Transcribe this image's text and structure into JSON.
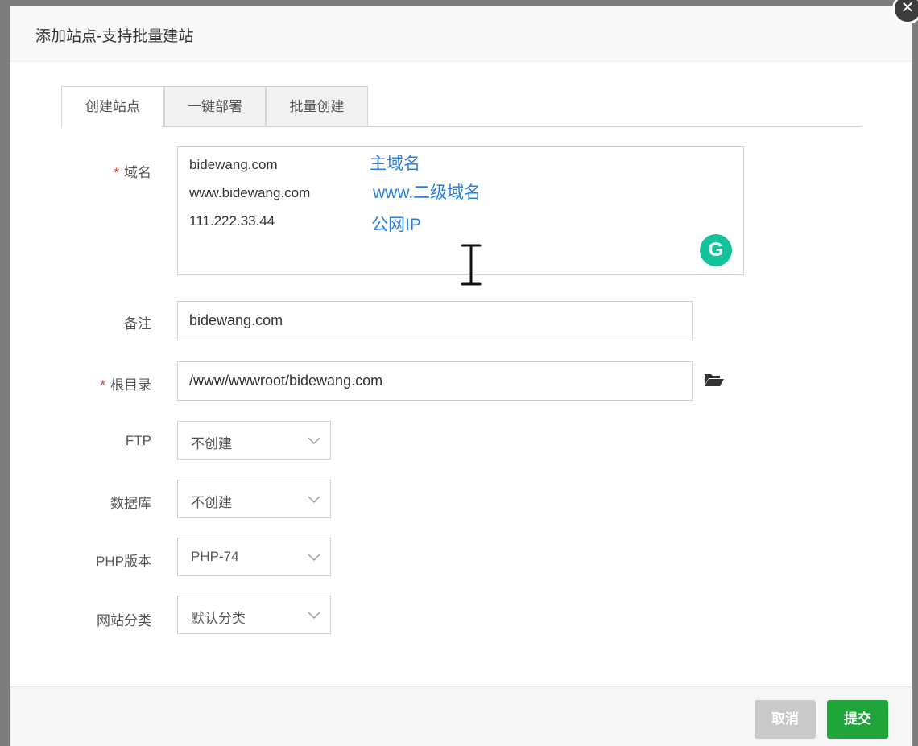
{
  "dialog": {
    "title": "添加站点-支持批量建站",
    "close_glyph": "✕"
  },
  "tabs": [
    {
      "label": "创建站点",
      "active": true
    },
    {
      "label": "一键部署",
      "active": false
    },
    {
      "label": "批量创建",
      "active": false
    }
  ],
  "form": {
    "domain": {
      "required_mark": "*",
      "label": "域名",
      "lines": [
        "bidewang.com",
        "www.bidewang.com",
        "111.222.33.44"
      ],
      "annotations": [
        "主域名",
        "www.二级域名",
        "公网IP"
      ],
      "extension_badge": "G"
    },
    "remark": {
      "label": "备注",
      "value": "bidewang.com"
    },
    "root_dir": {
      "required_mark": "*",
      "label": "根目录",
      "value": "/www/wwwroot/bidewang.com",
      "browse_icon": "folder-open-icon"
    },
    "ftp": {
      "label": "FTP",
      "value": "不创建"
    },
    "database": {
      "label": "数据库",
      "value": "不创建"
    },
    "php_version": {
      "label": "PHP版本",
      "value": "PHP-74"
    },
    "site_category": {
      "label": "网站分类",
      "value": "默认分类"
    }
  },
  "footer": {
    "cancel_label": "取消",
    "submit_label": "提交"
  },
  "colors": {
    "accent_green": "#20a53a",
    "annotation_blue": "#2b7fe0",
    "required_red": "#e53935",
    "grammarly_green": "#15c39a"
  }
}
